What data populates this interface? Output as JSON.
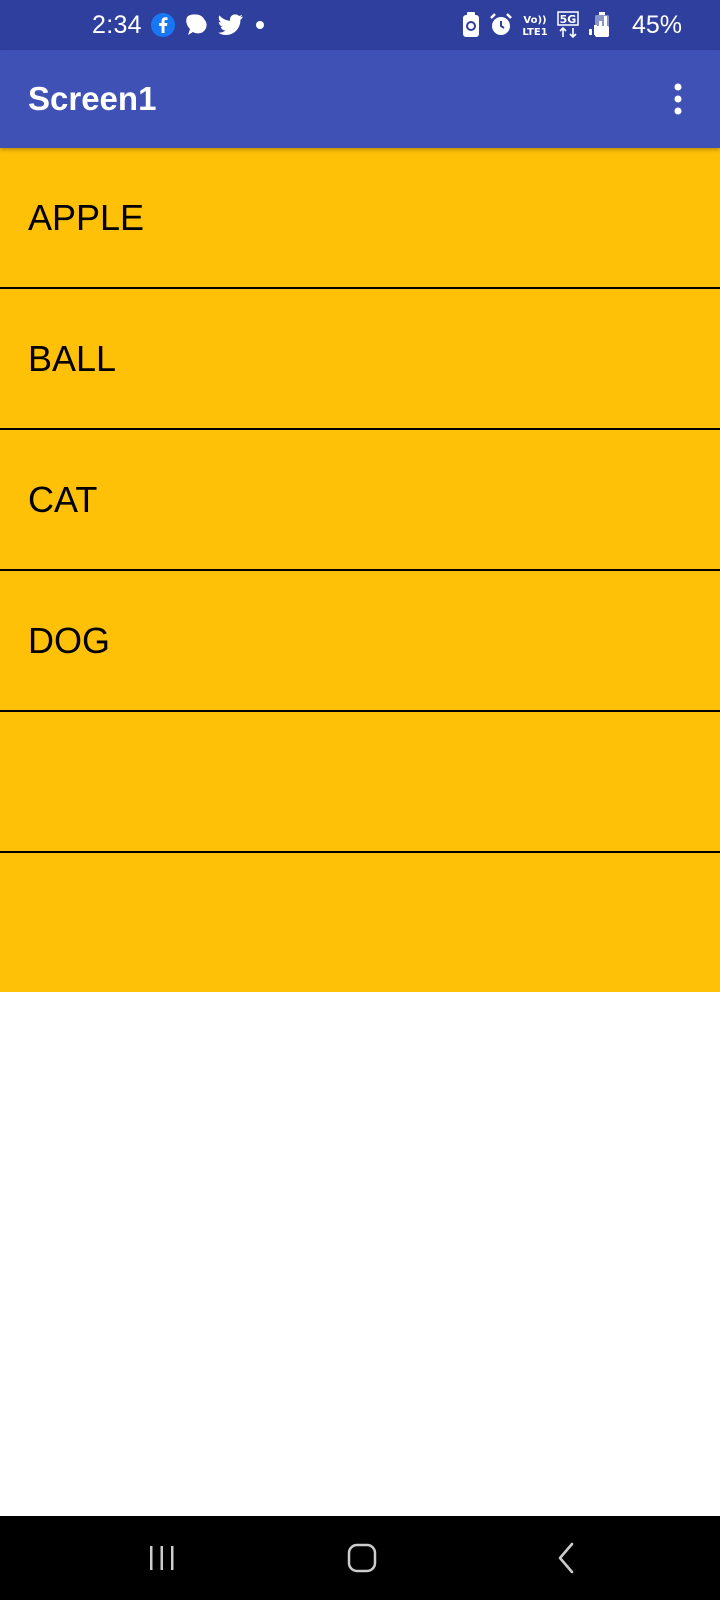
{
  "status_bar": {
    "time": "2:34",
    "battery_percent": "45%",
    "network": "5G",
    "colors": {
      "background": "#2F3F9E"
    },
    "icons": [
      "facebook-icon",
      "messenger-icon",
      "twitter-icon",
      "notification-dot-icon",
      "battery-saver-icon",
      "alarm-icon",
      "volte-icon",
      "5g-icon",
      "signal-icon",
      "battery-icon"
    ]
  },
  "app_bar": {
    "title": "Screen1",
    "menu_icon": "overflow-menu-icon",
    "colors": {
      "background": "#3F51B5",
      "text": "#FFFFFF"
    }
  },
  "list": {
    "colors": {
      "background": "#FFC107",
      "divider": "#000000",
      "text": "#000000"
    },
    "items": [
      {
        "label": "APPLE"
      },
      {
        "label": "BALL"
      },
      {
        "label": "CAT"
      },
      {
        "label": "DOG"
      },
      {
        "label": ""
      },
      {
        "label": ""
      }
    ]
  },
  "nav_bar": {
    "buttons": [
      "recents-icon",
      "home-icon",
      "back-icon"
    ]
  }
}
